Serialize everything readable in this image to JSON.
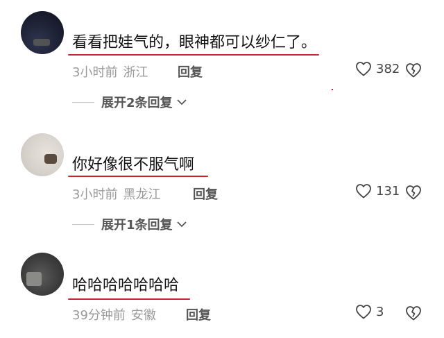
{
  "comments": [
    {
      "text": "看看把娃气的，眼神都可以纱仁了。",
      "time": "3小时前",
      "location": "浙江",
      "reply_label": "回复",
      "likes": "382",
      "expand_label": "展开2条回复"
    },
    {
      "text": "你好像很不服气啊",
      "time": "3小时前",
      "location": "黑龙江",
      "reply_label": "回复",
      "likes": "131",
      "expand_label": "展开1条回复"
    },
    {
      "text": "哈哈哈哈哈哈哈",
      "time": "39分钟前",
      "location": "安徽",
      "reply_label": "回复",
      "likes": "3"
    }
  ],
  "icons": {
    "like": "heart-outline-icon",
    "dislike": "broken-heart-icon",
    "expand": "chevron-down-icon"
  },
  "colors": {
    "underline": "#c8262a",
    "meta": "#9a9a9a"
  }
}
